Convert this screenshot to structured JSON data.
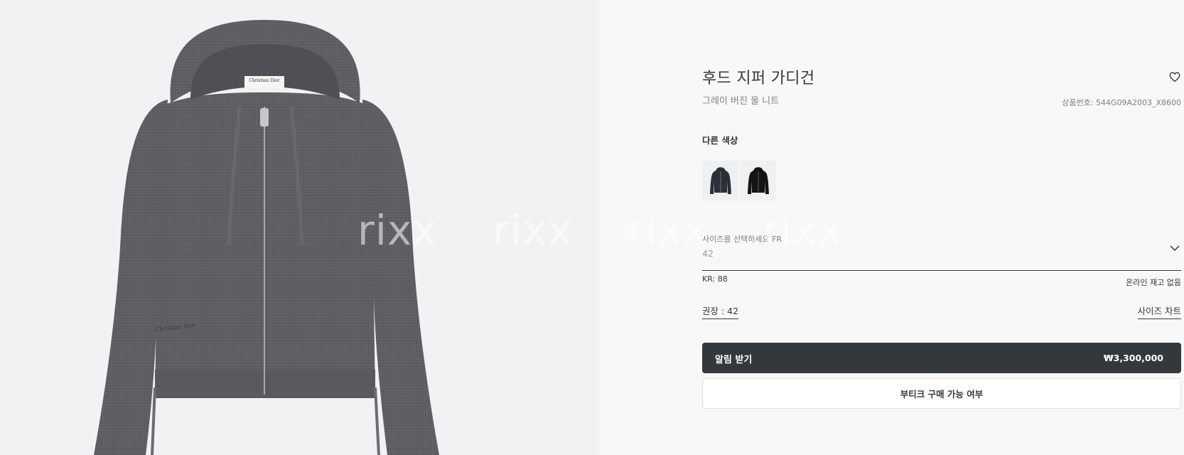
{
  "product": {
    "title": "후드 지퍼 가디건",
    "subtitle": "그레이 버진 울 니트",
    "reference": "상품번호: 544G09A2003_X8600",
    "brand_label": "Christian Dior",
    "embroidery": "Christian Dior"
  },
  "colors": {
    "label": "다른 색상",
    "swatches": [
      {
        "name": "navy",
        "color": "#2b2f3a"
      },
      {
        "name": "black",
        "color": "#141414"
      }
    ]
  },
  "size": {
    "label": "사이즈를 선택하세요 FR",
    "value": "42",
    "kr": "KR: 88",
    "stock": "온라인 재고 없음",
    "recommended": "권장 : 42",
    "chart_link": "사이즈 차트"
  },
  "actions": {
    "notify_label": "알림 받기",
    "price": "₩3,300,000",
    "boutique_label": "부티크 구매 가능 여부"
  },
  "watermark": {
    "text": "rixx"
  },
  "colors_theme": {
    "primary": "#33383c",
    "muted": "#7b8487",
    "gallery_bg": "#f1f2f4",
    "panel_bg": "#f8f8f8"
  },
  "icons": {
    "wishlist": "heart-icon",
    "dropdown": "chevron-down-icon"
  }
}
